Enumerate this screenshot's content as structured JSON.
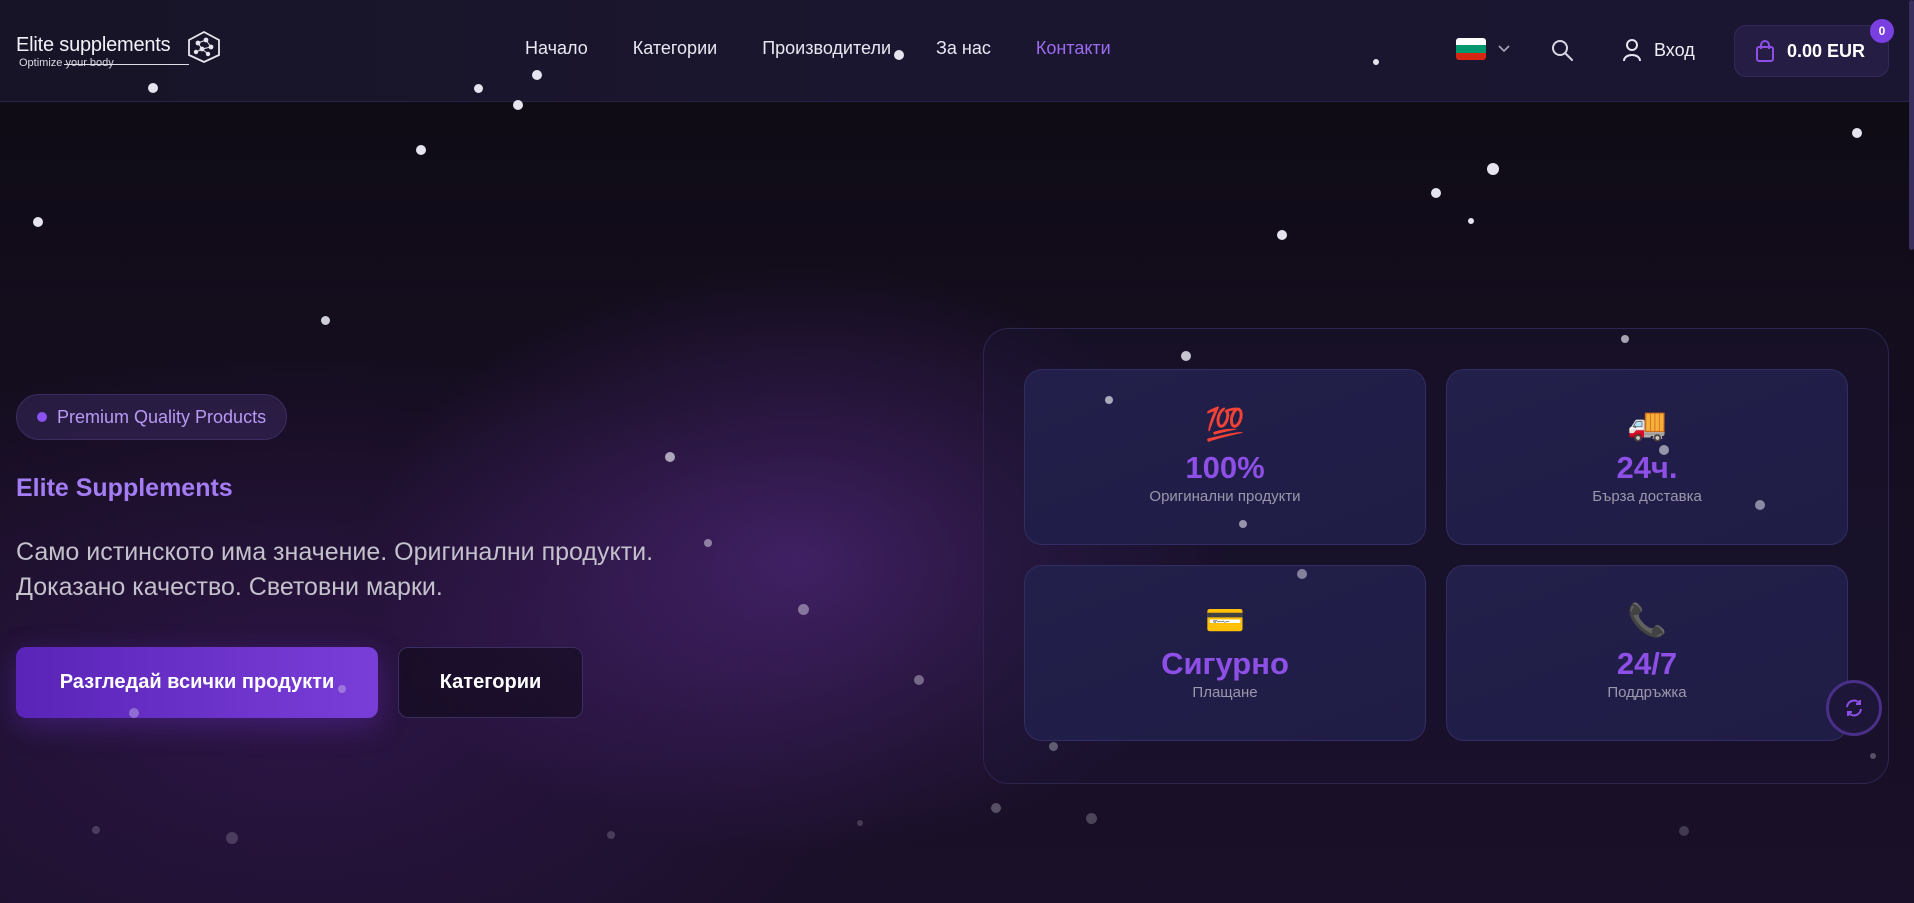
{
  "header": {
    "logo": {
      "title": "Elite supplements",
      "tagline": "Optimize your body"
    },
    "nav": [
      {
        "label": "Начало",
        "active": false
      },
      {
        "label": "Категории",
        "active": false
      },
      {
        "label": "Производители",
        "active": false
      },
      {
        "label": "За нас",
        "active": false
      },
      {
        "label": "Контакти",
        "active": true
      }
    ],
    "language": {
      "flag": "bulgarian-flag",
      "icon": "chevron-down-icon"
    },
    "search_icon": "search-icon",
    "login_label": "Вход",
    "cart": {
      "total": "0.00 EUR",
      "count": "0"
    }
  },
  "hero": {
    "badge": "Premium Quality Products",
    "title": "Elite Supplements",
    "subtitle": "Само истинското има значение. Оригинални продукти. Доказано качество. Световни марки.",
    "primary_button": "Разгледай всички продукти",
    "secondary_button": "Категории"
  },
  "stats": [
    {
      "emoji": "💯",
      "value": "100%",
      "label": "Оригинални продукти"
    },
    {
      "emoji": "🚚",
      "value": "24ч.",
      "label": "Бърза доставка"
    },
    {
      "emoji": "💳",
      "value": "Сигурно",
      "label": "Плащане"
    },
    {
      "emoji": "📞",
      "value": "24/7",
      "label": "Поддръжка"
    }
  ],
  "colors": {
    "accent": "#8d4fe6",
    "active_nav": "#9b6bf0",
    "background": "#140d1e"
  }
}
